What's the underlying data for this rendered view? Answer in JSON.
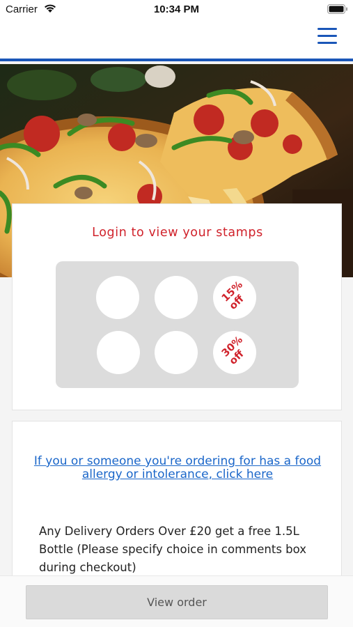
{
  "status_bar": {
    "carrier": "Carrier",
    "time": "10:34 PM"
  },
  "header": {
    "menu_icon": "hamburger-menu-icon",
    "accent_color": "#1a56b8"
  },
  "hero": {
    "image": "pizza-photo"
  },
  "stamp_card": {
    "title": "Login to view your stamps",
    "title_color": "#d0222b",
    "stamps": [
      {
        "label": ""
      },
      {
        "label": ""
      },
      {
        "label_line1": "15%",
        "label_line2": "off"
      },
      {
        "label": ""
      },
      {
        "label": ""
      },
      {
        "label_line1": "30%",
        "label_line2": "off"
      }
    ]
  },
  "info": {
    "allergy_link": "If you or someone you're ordering for has a food allergy or intolerance, click here",
    "promo": "Any Delivery Orders Over £20 get a free 1.5L Bottle (Please specify choice in comments box during checkout)"
  },
  "bottom": {
    "view_order_label": "View order"
  }
}
